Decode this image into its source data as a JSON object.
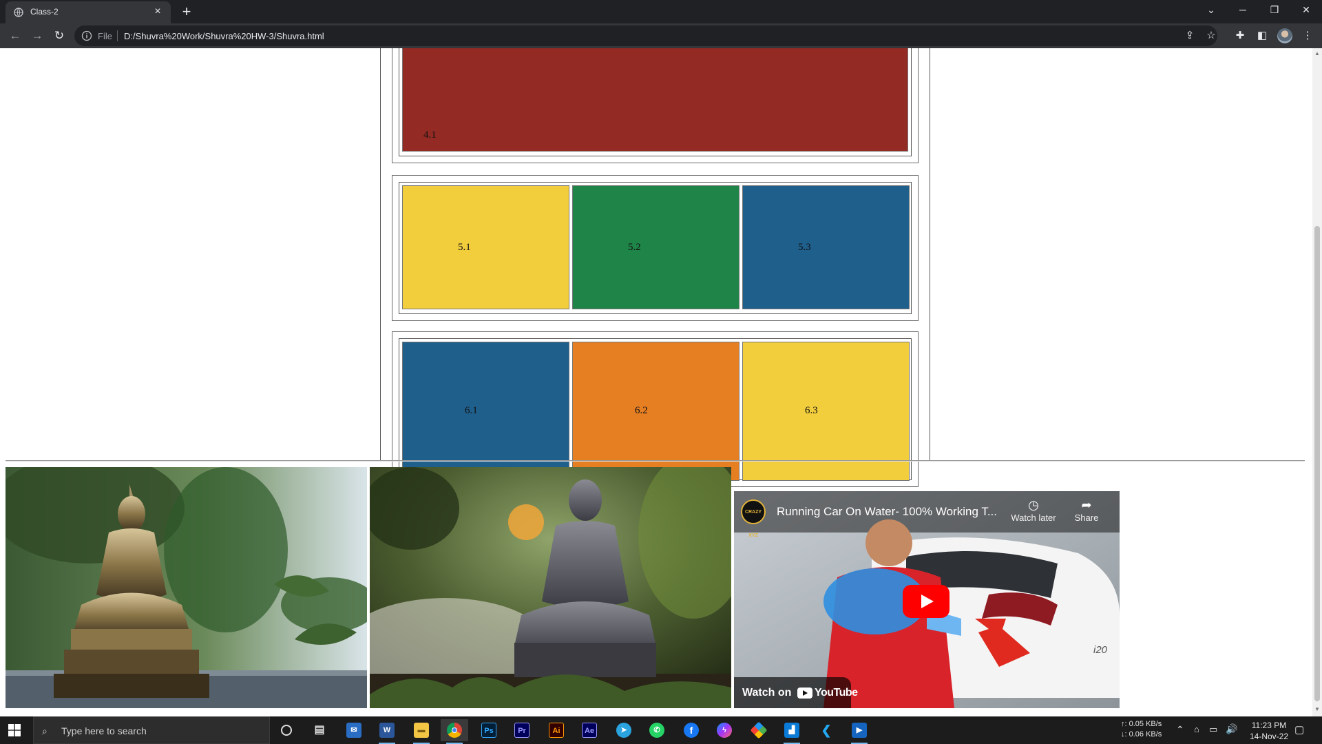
{
  "browser": {
    "tab_title": "Class-2",
    "tab_close": "×",
    "new_tab": "+",
    "scheme_label": "File",
    "url": "D:/Shuvra%20Work/Shuvra%20HW-3/Shuvra.html"
  },
  "page": {
    "rows": [
      {
        "id": "row4",
        "cells": [
          {
            "label": "4.1",
            "color": "#932b24"
          }
        ]
      },
      {
        "id": "row5",
        "cells": [
          {
            "label": "5.1",
            "color": "#f2cd3c"
          },
          {
            "label": "5.2",
            "color": "#1f8448"
          },
          {
            "label": "5.3",
            "color": "#1f5f8c"
          }
        ]
      },
      {
        "id": "row6",
        "cells": [
          {
            "label": "6.1",
            "color": "#1f5f8c"
          },
          {
            "label": "6.2",
            "color": "#e67e22"
          },
          {
            "label": "6.3",
            "color": "#f2cd3c"
          }
        ]
      }
    ],
    "video": {
      "title": "Running Car On Water- 100% Working T...",
      "channel_logo": "CRAZY XYZ",
      "watch_later": "Watch later",
      "share": "Share",
      "watch_on": "Watch on",
      "youtube": "YouTube",
      "car_badge": "i20"
    }
  },
  "taskbar": {
    "search_placeholder": "Type here to search",
    "network_up": "↑: 0.05 KB/s",
    "network_down": "↓: 0.06 KB/s",
    "time": "11:23 PM",
    "date": "14-Nov-22",
    "apps": [
      "cortana",
      "task-view",
      "mail",
      "word",
      "file-explorer",
      "chrome",
      "photoshop",
      "premiere",
      "illustrator",
      "after-effects",
      "telegram",
      "whatsapp",
      "facebook",
      "messenger",
      "app-diamond",
      "app-blue",
      "vscode",
      "media-player"
    ]
  }
}
